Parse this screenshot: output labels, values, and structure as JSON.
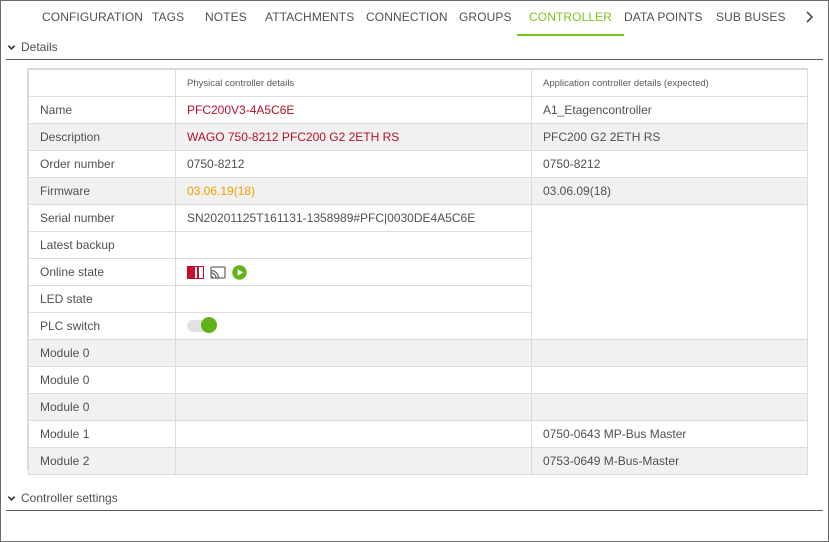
{
  "tabs": [
    {
      "label": "CONFIGURATION",
      "active": false
    },
    {
      "label": "TAGS",
      "active": false
    },
    {
      "label": "NOTES",
      "active": false
    },
    {
      "label": "ATTACHMENTS",
      "active": false
    },
    {
      "label": "CONNECTION",
      "active": false
    },
    {
      "label": "GROUPS",
      "active": false
    },
    {
      "label": "CONTROLLER",
      "active": true
    },
    {
      "label": "DATA POINTS",
      "active": false
    },
    {
      "label": "SUB BUSES",
      "active": false
    }
  ],
  "colors": {
    "accent": "#7dc31f",
    "value_red": "#b3112b",
    "firmware_orange": "#f0a000",
    "toggle_green": "#63b21a"
  },
  "details_section": {
    "label": "Details",
    "expanded": true
  },
  "settings_section": {
    "label": "Controller settings",
    "expanded": true
  },
  "table": {
    "headers": [
      "",
      "Physical controller details",
      "Application controller details (expected)"
    ],
    "rows": [
      {
        "label": "Name",
        "physical": "PFC200V3-4A5C6E",
        "application": "A1_Etagencontroller"
      },
      {
        "label": "Description",
        "physical": "WAGO 750-8212 PFC200 G2 2ETH RS",
        "application": "PFC200 G2 2ETH RS"
      },
      {
        "label": "Order number",
        "physical": "0750-8212",
        "application": "0750-8212"
      },
      {
        "label": "Firmware",
        "physical": "03.06.19(18)",
        "application": "03.06.09(18)"
      },
      {
        "label": "Serial number",
        "physical": "SN20201125T161131-1358989#PFC|0030DE4A5C6E",
        "application": ""
      },
      {
        "label": "Latest backup",
        "physical": "",
        "application": ""
      },
      {
        "label": "Online state",
        "physical": "",
        "application": "",
        "icons": [
          "controller-state-icon",
          "cast-icon",
          "play-icon"
        ]
      },
      {
        "label": "LED state",
        "physical": "",
        "application": ""
      },
      {
        "label": "PLC switch",
        "physical": "",
        "application": "",
        "toggle_on": true
      },
      {
        "label": "Module 0",
        "physical": "",
        "application": ""
      },
      {
        "label": "Module 0",
        "physical": "",
        "application": ""
      },
      {
        "label": "Module 0",
        "physical": "",
        "application": ""
      },
      {
        "label": "Module 1",
        "physical": "",
        "application": "0750-0643 MP-Bus Master"
      },
      {
        "label": "Module 2",
        "physical": "",
        "application": "0753-0649 M-Bus-Master"
      }
    ]
  }
}
